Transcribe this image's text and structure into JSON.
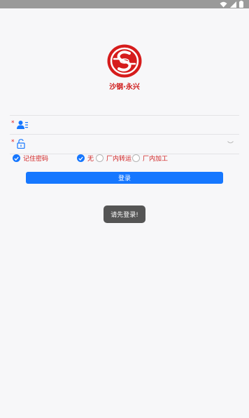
{
  "status_bar": {
    "icons": [
      "wifi-icon",
      "signal-icon",
      "battery-icon"
    ]
  },
  "brand": {
    "app_name": "沙钢·永兴",
    "logo_color": "#d61c1c"
  },
  "form": {
    "username": {
      "placeholder": "",
      "value": ""
    },
    "password": {
      "placeholder": "",
      "value": ""
    },
    "required_mark": "*"
  },
  "options": {
    "remember_password": {
      "label": "记住密码",
      "checked": true
    },
    "modes": [
      {
        "label": "无",
        "checked": true
      },
      {
        "label": "厂内转运",
        "checked": false
      },
      {
        "label": "厂内加工",
        "checked": false
      }
    ]
  },
  "login_button": {
    "label": "登录"
  },
  "toast": {
    "message": "请先登录!"
  },
  "colors": {
    "primary": "#1677ff",
    "accent_red": "#d02020"
  }
}
